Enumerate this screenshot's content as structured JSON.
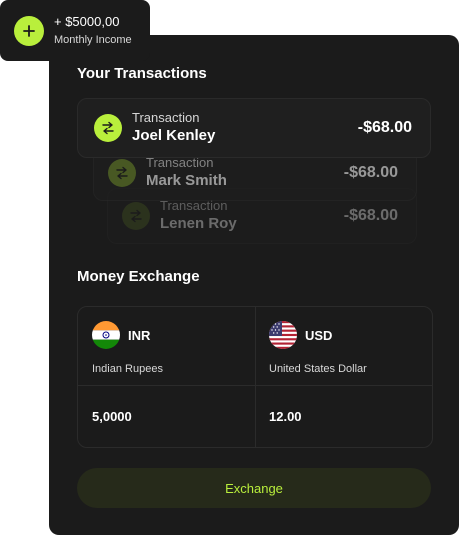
{
  "income": {
    "amount": "+ $5000,00",
    "label": "Monthly Income",
    "icon": "plus-icon"
  },
  "transactions": {
    "title": "Your Transactions",
    "items": [
      {
        "label": "Transaction",
        "name": "Joel Kenley",
        "amount": "-$68.00",
        "icon": "swap-arrows-icon",
        "icon_bg": "#b9ef3c"
      },
      {
        "label": "Transaction",
        "name": "Mark Smith",
        "amount": "-$68.00",
        "icon": "swap-arrows-icon",
        "icon_bg": "#6d8b2a"
      },
      {
        "label": "Transaction",
        "name": "Lenen Roy",
        "amount": "-$68.00",
        "icon": "swap-arrows-icon",
        "icon_bg": "#4b5d23"
      }
    ]
  },
  "exchange": {
    "title": "Money Exchange",
    "from": {
      "code": "INR",
      "desc": "Indian Rupees",
      "value": "5,0000",
      "flag_icon": "india-flag-icon"
    },
    "to": {
      "code": "USD",
      "desc": "United States Dollar",
      "value": "12.00",
      "flag_icon": "us-flag-icon"
    },
    "button_label": "Exchange"
  },
  "colors": {
    "accent": "#b9ef3c",
    "panel_bg": "#1b1b1b",
    "button_bg": "#262a1a"
  }
}
